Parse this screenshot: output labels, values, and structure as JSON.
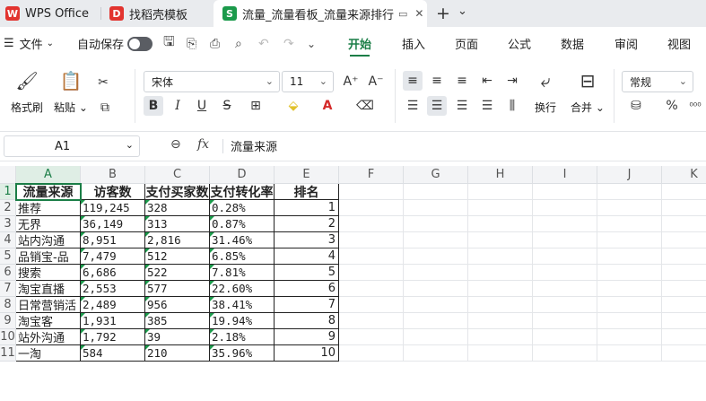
{
  "tabs": [
    {
      "label": "WPS Office",
      "icon": "wps-icon"
    },
    {
      "label": "找稻壳模板",
      "icon": "docer-icon"
    },
    {
      "label": "流量_流量看板_流量来源排行",
      "icon": "sheet-icon"
    }
  ],
  "tabbar": {
    "new_tab": "+",
    "dropdown": "⌄"
  },
  "menu": {
    "file": "文件",
    "autosave": "自动保存",
    "items": [
      "开始",
      "插入",
      "页面",
      "公式",
      "数据",
      "审阅",
      "视图"
    ],
    "active": "开始"
  },
  "ribbon": {
    "format_painter": "格式刷",
    "paste": "粘贴",
    "font_name": "宋体",
    "font_size": "11",
    "wrap": "换行",
    "merge": "合并",
    "number_format": "常规",
    "bold": "B",
    "italic": "I",
    "underline": "U",
    "strike": "S",
    "percent": "%"
  },
  "formula_bar": {
    "cell_ref": "A1",
    "formula": "流量来源",
    "fx": "fx"
  },
  "columns": [
    "A",
    "B",
    "C",
    "D",
    "E",
    "F",
    "G",
    "H",
    "I",
    "J",
    "K"
  ],
  "rows": [
    "1",
    "2",
    "3",
    "4",
    "5",
    "6",
    "7",
    "8",
    "9",
    "10",
    "11"
  ],
  "table": {
    "headers": [
      "流量来源",
      "访客数",
      "支付买家数",
      "支付转化率",
      "排名"
    ],
    "data": [
      [
        "推荐",
        "119,245",
        "328",
        "0.28%",
        "1"
      ],
      [
        "无界",
        "36,149",
        "313",
        "0.87%",
        "2"
      ],
      [
        "站内沟通",
        "8,951",
        "2,816",
        "31.46%",
        "3"
      ],
      [
        "品销宝-品",
        "7,479",
        "512",
        "6.85%",
        "4"
      ],
      [
        "搜索",
        "6,686",
        "522",
        "7.81%",
        "5"
      ],
      [
        "淘宝直播",
        "2,553",
        "577",
        "22.60%",
        "6"
      ],
      [
        "日常营销活",
        "2,489",
        "956",
        "38.41%",
        "7"
      ],
      [
        "淘宝客",
        "1,931",
        "385",
        "19.94%",
        "8"
      ],
      [
        "站外沟通",
        "1,792",
        "39",
        "2.18%",
        "9"
      ],
      [
        "一淘",
        "584",
        "210",
        "35.96%",
        "10"
      ]
    ]
  },
  "colors": {
    "accent": "#1b7e47",
    "tabbar": "#e9ebee"
  }
}
